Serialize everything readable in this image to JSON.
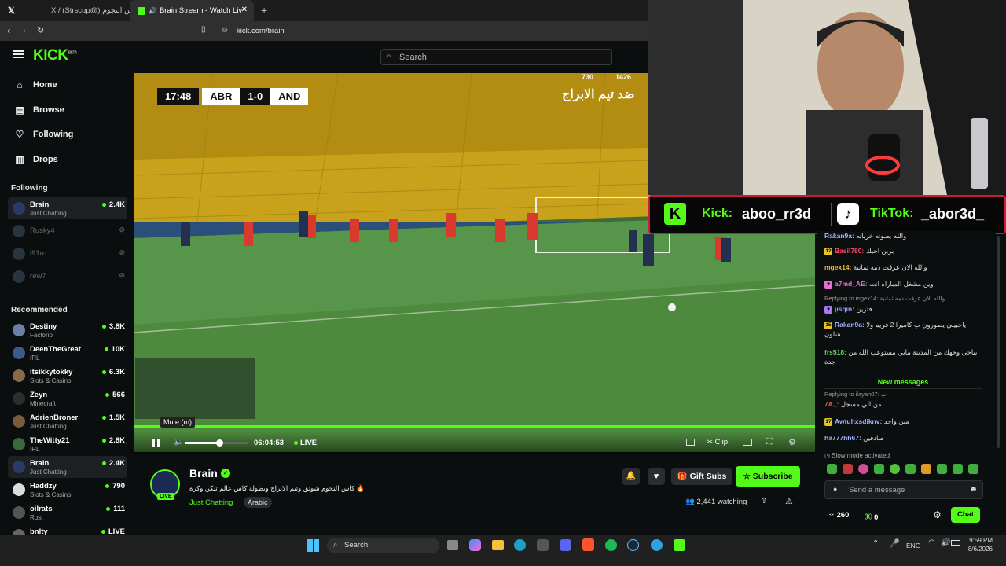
{
  "browser": {
    "tabs": [
      {
        "label": "X / (Strscup@) كأس النجوم",
        "active": false
      },
      {
        "label": "Brain Stream - Watch Live on",
        "active": true
      }
    ],
    "url": "kick.com/brain"
  },
  "kick": {
    "logo": "KICK",
    "logo_badge": "BETA",
    "search_placeholder": "Search",
    "nav": [
      {
        "label": "Home",
        "icon": "home-icon"
      },
      {
        "label": "Browse",
        "icon": "browse-icon"
      },
      {
        "label": "Following",
        "icon": "heart-icon"
      },
      {
        "label": "Drops",
        "icon": "drops-icon"
      }
    ],
    "following_title": "Following",
    "following": [
      {
        "name": "Brain",
        "category": "Just Chatting",
        "viewers": "2.4K",
        "live": true
      },
      {
        "name": "Rusky4",
        "category": "",
        "viewers": "",
        "live": false
      },
      {
        "name": "i91ro",
        "category": "",
        "viewers": "",
        "live": false
      },
      {
        "name": "rew7",
        "category": "",
        "viewers": "",
        "live": false
      }
    ],
    "recommended_title": "Recommended",
    "recommended": [
      {
        "name": "Destiny",
        "category": "Factorio",
        "viewers": "3.8K"
      },
      {
        "name": "DeenTheGreat",
        "category": "IRL",
        "viewers": "10K"
      },
      {
        "name": "itsikkytokky",
        "category": "Slots & Casino",
        "viewers": "6.3K"
      },
      {
        "name": "Zeyn",
        "category": "Minecraft",
        "viewers": "566"
      },
      {
        "name": "AdrienBroner",
        "category": "Just Chatting",
        "viewers": "1.5K"
      },
      {
        "name": "TheWitty21",
        "category": "IRL",
        "viewers": "2.8K"
      },
      {
        "name": "Brain",
        "category": "Just Chatting",
        "viewers": "2.4K"
      },
      {
        "name": "Haddzy",
        "category": "Slots & Casino",
        "viewers": "790"
      },
      {
        "name": "oilrats",
        "category": "Rust",
        "viewers": "111"
      },
      {
        "name": "bnlty",
        "category": "",
        "viewers": "LIVE"
      }
    ]
  },
  "video": {
    "scoreboard": {
      "time": "17:48",
      "home": "ABR",
      "score": "1-0",
      "away": "AND"
    },
    "overlay_text": "ضد تيم الابراج",
    "corner_stats": [
      "730",
      "1426"
    ],
    "tooltip": "Mute (m)",
    "elapsed": "06:04:53",
    "live_label": "LIVE",
    "clip_label": "Clip",
    "volume_level": 0.55
  },
  "stream": {
    "streamer": "Brain",
    "title": "كاس النجوم شوتق وتيم الابراج وبطولة كاس عالم تيكن وكرة 🔥",
    "category": "Just Chatting",
    "tag": "Arabic",
    "live_badge": "LIVE",
    "watching": "2,441 watching",
    "gift_label": "Gift Subs",
    "subscribe_label": "Subscribe"
  },
  "overlay_banner": {
    "kick_label": "Kick:",
    "kick_handle": "aboo_rr3d",
    "tiktok_label": "TikTok:",
    "tiktok_handle": "_abor3d_"
  },
  "chat": {
    "messages": [
      {
        "user": "Rakan9a:",
        "text": "والله بصوته خربانه",
        "badge": "",
        "color": "#9fb3ff"
      },
      {
        "user": "Basil780:",
        "text": "برين احبك",
        "badge": "12",
        "color": "#ff4d6d"
      },
      {
        "user": "mgex14:",
        "text": "والله الان عرفت دمه ثمانية",
        "badge": "",
        "color": "#f2b632"
      },
      {
        "user": "a7md_AE:",
        "text": "وين مشغل المباراه انت",
        "badge": "♥",
        "color": "#e86bd6"
      },
      {
        "user": "jisqin:",
        "text": "قترين",
        "badge": "♥",
        "color": "#8fa6ff"
      },
      {
        "user": "Rakan9a:",
        "text": "ياحبيبي يصورون ب كاميرا 2 فريم ولا شلون",
        "badge": "15",
        "color": "#9fb3ff"
      },
      {
        "user": "frs518:",
        "text": "بياخي وجهك من المدينة مابي مستوعب الله من جدة",
        "badge": "",
        "color": "#65d65f"
      },
      {
        "user": "7A_:",
        "text": "من الي مسجل",
        "badge": "",
        "color": "#ff5c5c"
      },
      {
        "user": "Awtuhxsdiknv:",
        "text": "مين واحد",
        "badge": "17",
        "color": "#9fb3ff"
      },
      {
        "user": "ha777hh67:",
        "text": "صادقين",
        "badge": "",
        "color": "#9fb3ff"
      }
    ],
    "replies": [
      "Replying to mgex14: والله الان عرفت دمه ثمانية",
      "Replying to ilayan07: ب"
    ],
    "new_messages": "New messages",
    "slow_mode": "Slow mode activated",
    "input_placeholder": "Send a message",
    "points": "260",
    "kicks": "0",
    "chat_button": "Chat"
  },
  "taskbar": {
    "search_label": "Search",
    "lang": "ENG",
    "time": "9:59 PM",
    "date": "8/6/2026"
  }
}
